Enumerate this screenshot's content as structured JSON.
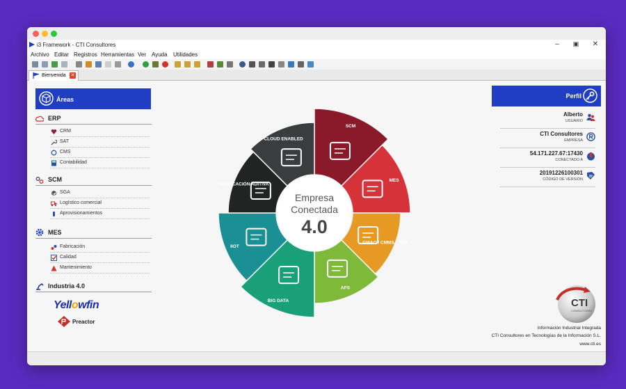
{
  "window": {
    "title": "i3 Framework - CTI Consultores"
  },
  "menu": [
    "Archivo",
    "Editar",
    "Registros",
    "Herramientas",
    "Ver",
    "Ayuda",
    "Utilidades"
  ],
  "tab": {
    "label": "Bienvenida",
    "close": "✕"
  },
  "areas": {
    "title": "Áreas",
    "sections": [
      {
        "label": "ERP",
        "items": [
          "CRM",
          "SAT",
          "CMS",
          "Contabilidad"
        ]
      },
      {
        "label": "SCM",
        "items": [
          "SGA",
          "Logístico comercial",
          "Aprovisionamientos"
        ]
      },
      {
        "label": "MES",
        "items": [
          "Fabricación",
          "Calidad",
          "Mantenimiento"
        ]
      },
      {
        "label": "Industria 4.0",
        "items": []
      }
    ],
    "logos": {
      "yellowfin_a": "Yell",
      "yellowfin_o": "o",
      "yellowfin_b": "wfin",
      "preactor": "Preactor"
    }
  },
  "wheel": {
    "center_line1": "Empresa",
    "center_line2": "Conectada",
    "center_version": "4.0",
    "segments": [
      {
        "label": "SCM",
        "color": "#8a1a2a"
      },
      {
        "label": "MES",
        "color": "#d53239"
      },
      {
        "label": "GMAO / CMMS / TPM",
        "color": "#e69a24"
      },
      {
        "label": "APS",
        "color": "#7fb93a"
      },
      {
        "label": "BIG DATA",
        "color": "#1aa079"
      },
      {
        "label": "IIOT",
        "color": "#1a8f94"
      },
      {
        "label": "FABRICACIÓN ADITIVA",
        "color": "#222424"
      },
      {
        "label": "CLOUD ENABLED",
        "color": "#3a3d3d"
      }
    ]
  },
  "perfil": {
    "title": "Perfil",
    "entries": [
      {
        "value": "Alberto",
        "label": "USUARIO"
      },
      {
        "value": "CTI Consultores",
        "label": "EMPRESA"
      },
      {
        "value": "54.171.227.67:17430",
        "label": "CONECTADO A"
      },
      {
        "value": "20191226100301",
        "label": "CÓDIGO DE VERSIÓN"
      }
    ]
  },
  "footer": {
    "logo_text": "CTI",
    "logo_sub": "CONSULTORES",
    "line1": "Información Industrial Integrada",
    "line2": "CTI Consultores en Tecnologías de la Información S.L.",
    "line3": "www.cti.es"
  }
}
